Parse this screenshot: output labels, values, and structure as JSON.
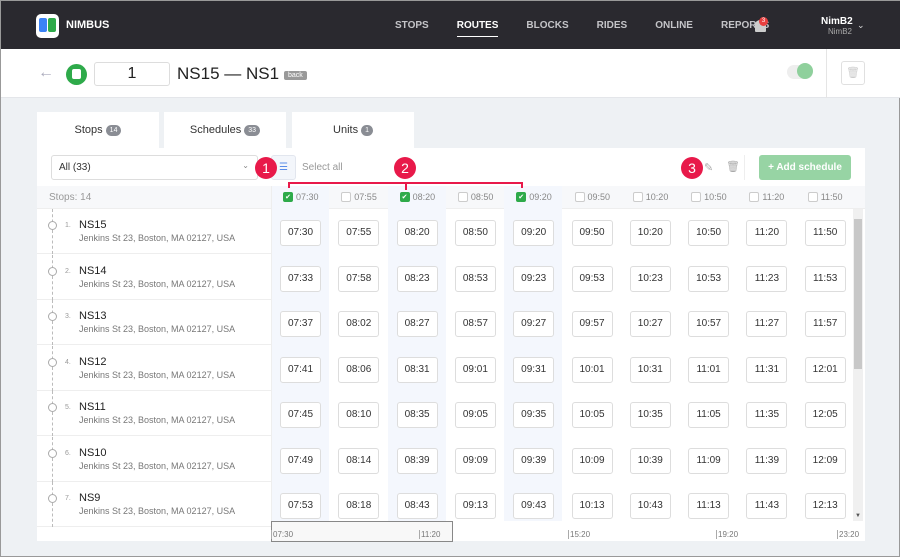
{
  "nav": {
    "brand": "NIMBUS",
    "links": [
      "STOPS",
      "ROUTES",
      "BLOCKS",
      "RIDES",
      "ONLINE",
      "REPORTS"
    ],
    "active": "ROUTES",
    "notifications": "3",
    "user_name": "NimB2",
    "user_sub": "NimB2"
  },
  "header": {
    "route_number": "1",
    "route_title": "NS15 — NS1",
    "direction_tag": "back",
    "active": true
  },
  "tabs": [
    {
      "label": "Stops",
      "count": "14"
    },
    {
      "label": "Schedules",
      "count": "33"
    },
    {
      "label": "Units",
      "count": "1"
    }
  ],
  "toolbar": {
    "filter_value": "All (33)",
    "select_all": "Select all",
    "add_schedule": "+ Add schedule"
  },
  "annotations": [
    "1",
    "2",
    "3"
  ],
  "colors": {
    "accent": "#2eaa4a",
    "annotation": "#e8194a",
    "nav_bg": "#2a292f"
  },
  "grid": {
    "stops_count": "Stops: 14",
    "columns": [
      {
        "time": "07:30",
        "checked": true
      },
      {
        "time": "07:55",
        "checked": false
      },
      {
        "time": "08:20",
        "checked": true
      },
      {
        "time": "08:50",
        "checked": false
      },
      {
        "time": "09:20",
        "checked": true
      },
      {
        "time": "09:50",
        "checked": false
      },
      {
        "time": "10:20",
        "checked": false
      },
      {
        "time": "10:50",
        "checked": false
      },
      {
        "time": "11:20",
        "checked": false
      },
      {
        "time": "11:50",
        "checked": false
      }
    ],
    "rows": [
      {
        "index": "1.",
        "name": "NS15",
        "address": "Jenkins St 23, Boston, MA 02127, USA",
        "times": [
          "07:30",
          "07:55",
          "08:20",
          "08:50",
          "09:20",
          "09:50",
          "10:20",
          "10:50",
          "11:20",
          "11:50"
        ]
      },
      {
        "index": "2.",
        "name": "NS14",
        "address": "Jenkins St 23, Boston, MA 02127, USA",
        "times": [
          "07:33",
          "07:58",
          "08:23",
          "08:53",
          "09:23",
          "09:53",
          "10:23",
          "10:53",
          "11:23",
          "11:53"
        ]
      },
      {
        "index": "3.",
        "name": "NS13",
        "address": "Jenkins St 23, Boston, MA 02127, USA",
        "times": [
          "07:37",
          "08:02",
          "08:27",
          "08:57",
          "09:27",
          "09:57",
          "10:27",
          "10:57",
          "11:27",
          "11:57"
        ]
      },
      {
        "index": "4.",
        "name": "NS12",
        "address": "Jenkins St 23, Boston, MA 02127, USA",
        "times": [
          "07:41",
          "08:06",
          "08:31",
          "09:01",
          "09:31",
          "10:01",
          "10:31",
          "11:01",
          "11:31",
          "12:01"
        ]
      },
      {
        "index": "5.",
        "name": "NS11",
        "address": "Jenkins St 23, Boston, MA 02127, USA",
        "times": [
          "07:45",
          "08:10",
          "08:35",
          "09:05",
          "09:35",
          "10:05",
          "10:35",
          "11:05",
          "11:35",
          "12:05"
        ]
      },
      {
        "index": "6.",
        "name": "NS10",
        "address": "Jenkins St 23, Boston, MA 02127, USA",
        "times": [
          "07:49",
          "08:14",
          "08:39",
          "09:09",
          "09:39",
          "10:09",
          "10:39",
          "11:09",
          "11:39",
          "12:09"
        ]
      },
      {
        "index": "7.",
        "name": "NS9",
        "address": "Jenkins St 23, Boston, MA 02127, USA",
        "times": [
          "07:53",
          "08:18",
          "08:43",
          "09:13",
          "09:43",
          "10:13",
          "10:43",
          "11:13",
          "11:43",
          "12:13"
        ]
      }
    ]
  },
  "timeline": {
    "ticks": [
      "07:30",
      "11:20",
      "15:20",
      "19:20",
      "23:20"
    ]
  }
}
